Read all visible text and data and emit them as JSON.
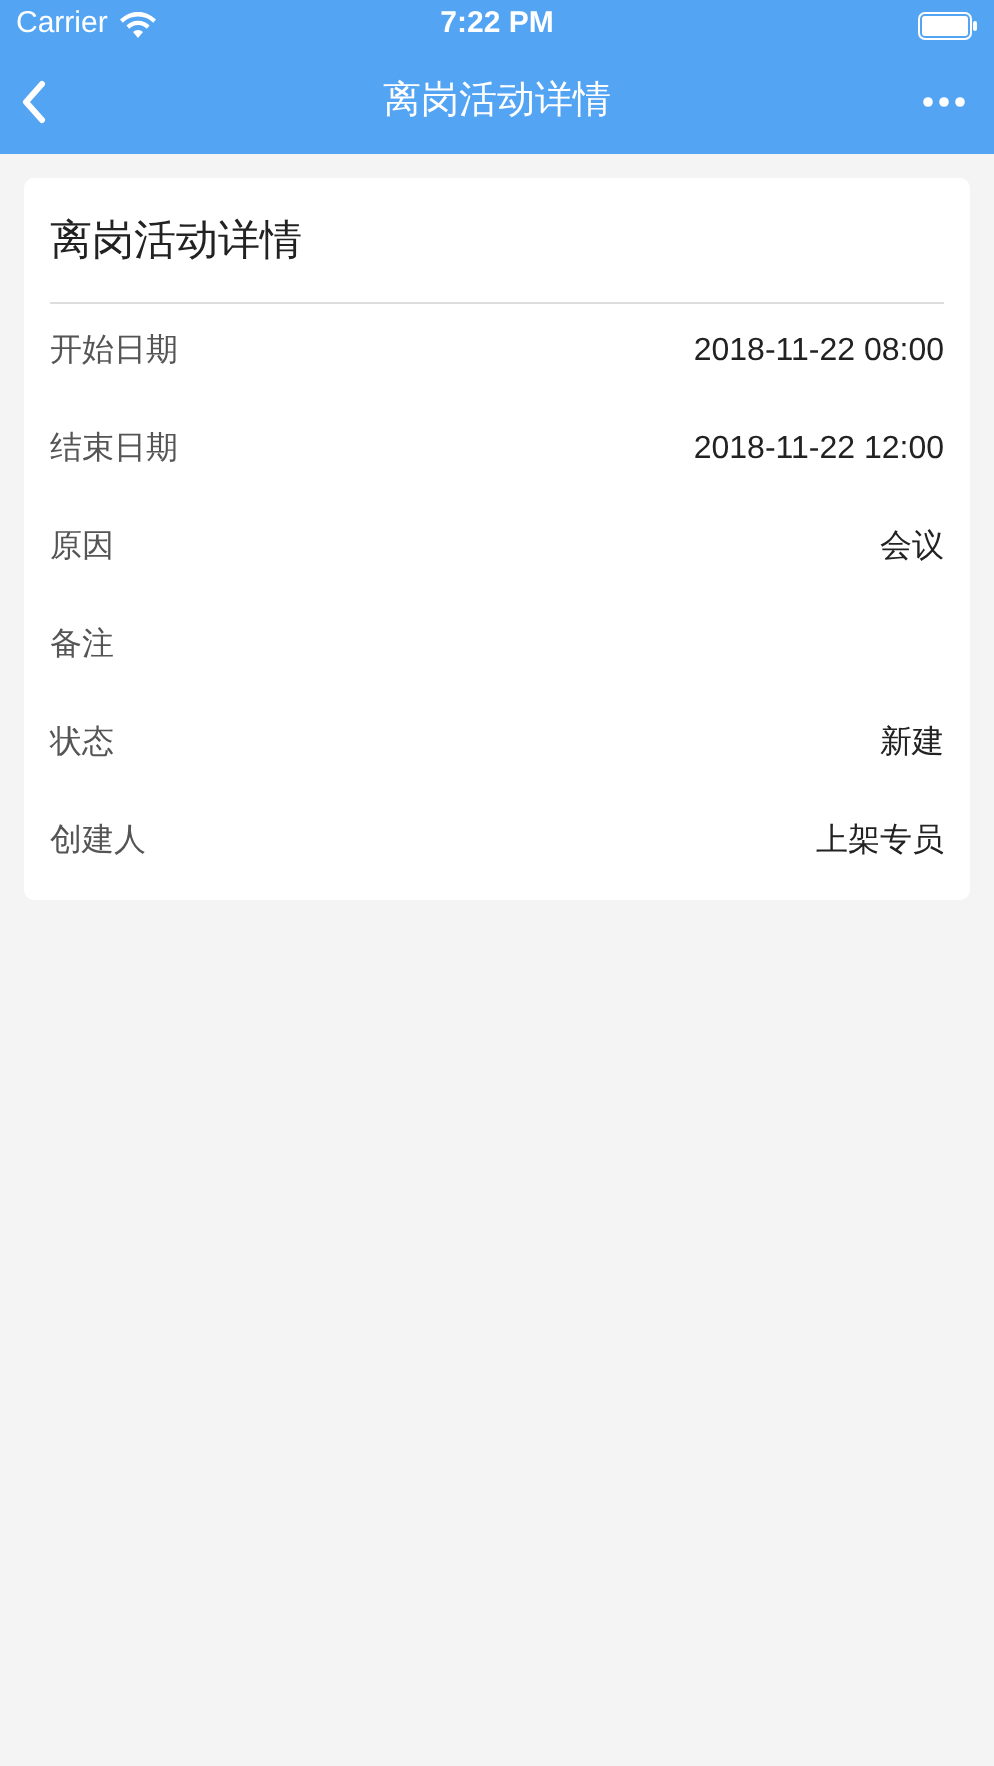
{
  "status_bar": {
    "carrier": "Carrier",
    "time": "7:22 PM"
  },
  "nav_bar": {
    "title": "离岗活动详情"
  },
  "card": {
    "title": "离岗活动详情",
    "rows": [
      {
        "label": "开始日期",
        "value": "2018-11-22 08:00"
      },
      {
        "label": "结束日期",
        "value": "2018-11-22 12:00"
      },
      {
        "label": "原因",
        "value": "会议"
      },
      {
        "label": "备注"
      },
      {
        "label": "状态",
        "value": "新建"
      },
      {
        "label": "创建人",
        "value": "上架专员"
      }
    ]
  }
}
